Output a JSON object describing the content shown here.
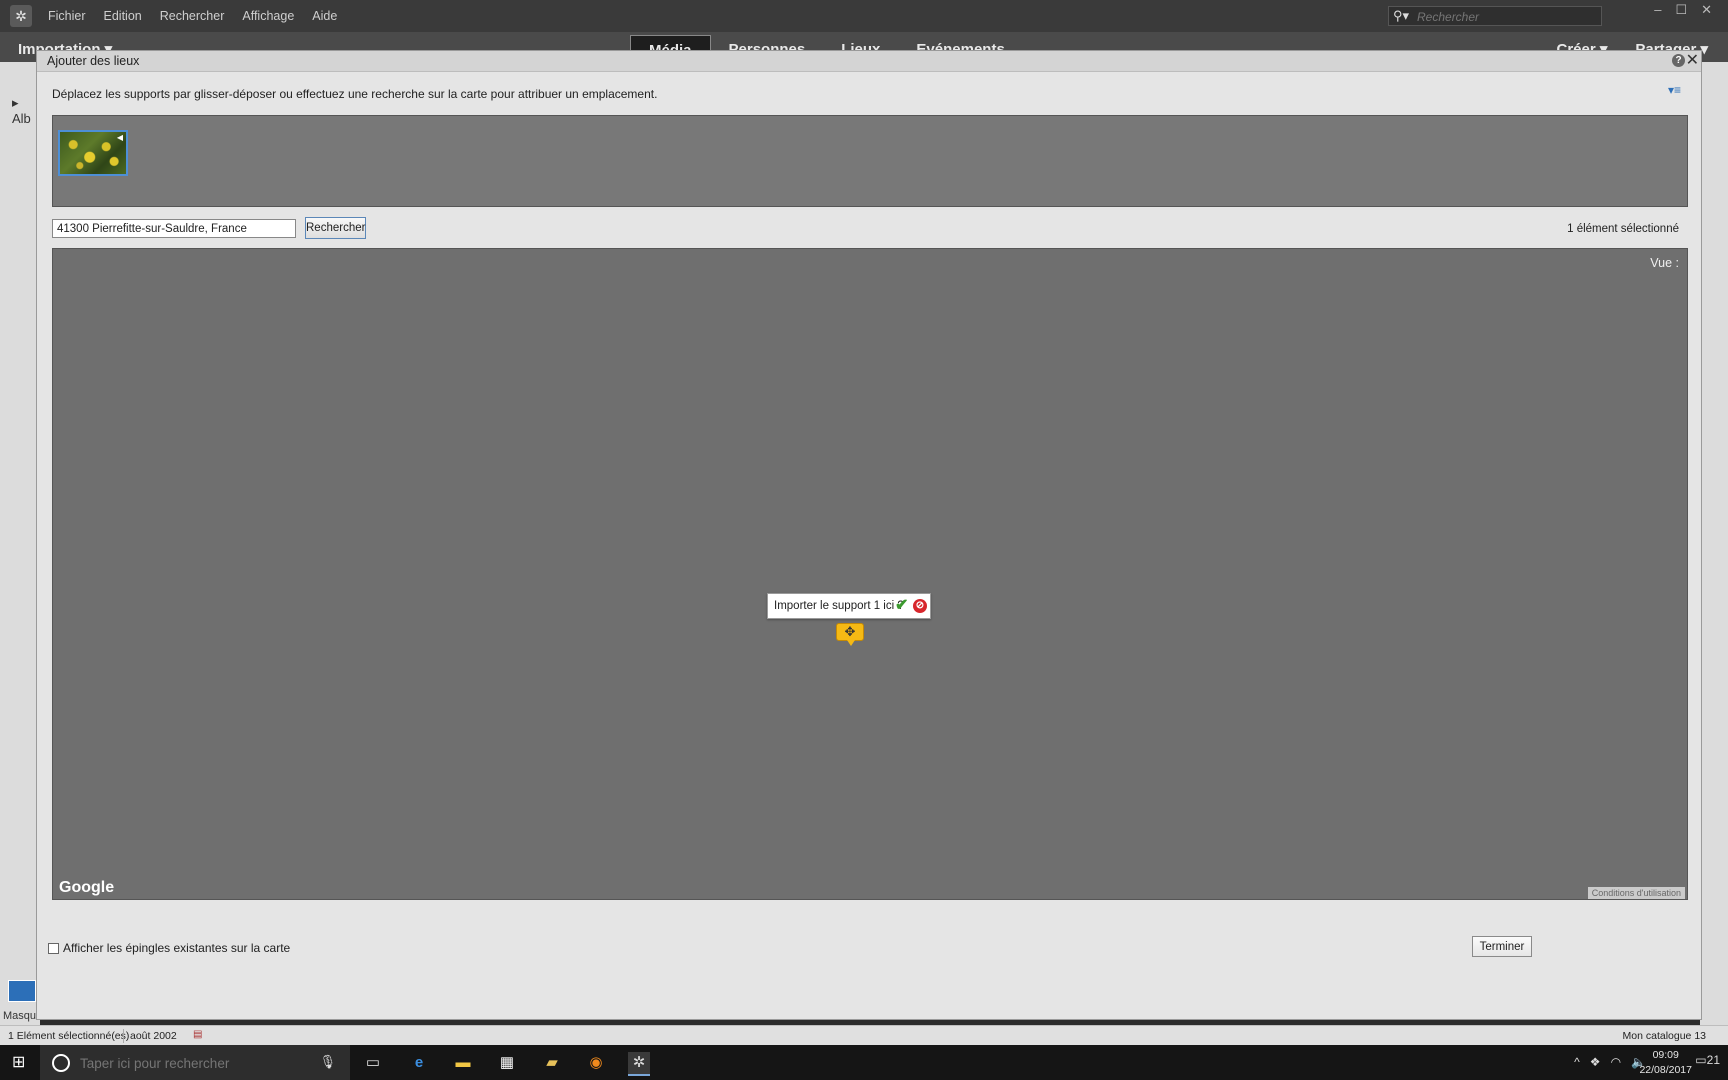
{
  "app": {
    "menu": [
      "Fichier",
      "Edition",
      "Rechercher",
      "Affichage",
      "Aide"
    ],
    "search_placeholder": "Rechercher",
    "mode_left": "Importation",
    "mode_tabs": [
      "Média",
      "Personnes",
      "Lieux",
      "Evénements"
    ],
    "mode_right": [
      "Créer",
      "Partager"
    ],
    "left_strip_label": "Alb",
    "left_strip_bottom": "Masque"
  },
  "dialog": {
    "title": "Ajouter des lieux",
    "instruction": "Déplacez les supports par glisser-déposer ou effectuez une recherche sur la carte pour attribuer un emplacement.",
    "location_value": "41300 Pierrefitte-sur-Sauldre, France",
    "search_button": "Rechercher",
    "selection_count": "1 élément sélectionné",
    "map": {
      "view_label": "Vue :",
      "google_logo": "Google",
      "terms": "Conditions d'utilisation",
      "popup_text": "Importer le support 1 ici ?"
    },
    "show_pins_label": "Afficher les épingles existantes sur la carte",
    "finish_button": "Terminer"
  },
  "status": {
    "selected": "1 Elément sélectionné(es)",
    "date": "août 2002",
    "catalog": "Mon catalogue  13"
  },
  "taskbar": {
    "search_placeholder": "Taper ici pour rechercher",
    "time": "09:09",
    "date": "22/08/2017",
    "notifications": "21"
  },
  "colors": {
    "map_bg": "#6f6f6f",
    "tray_bg": "#787878",
    "accent_blue": "#2c6fb8",
    "pin_yellow": "#f5b914",
    "confirm_green": "#3b9a2e",
    "cancel_red": "#d7262c"
  }
}
